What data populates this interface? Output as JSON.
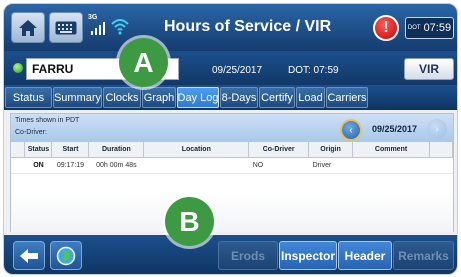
{
  "header": {
    "title": "Hours of Service / VIR",
    "network_label": "3G",
    "alert_label": "!",
    "dot_label": "DOT",
    "clock": "07:59"
  },
  "driver_bar": {
    "driver_name": "FARRU",
    "date": "09/25/2017",
    "dot_time": "DOT: 07:59",
    "vir_label": "VIR"
  },
  "tabs": [
    {
      "label": "Status"
    },
    {
      "label": "Summary"
    },
    {
      "label": "Clocks"
    },
    {
      "label": "Graph"
    },
    {
      "label": "Day Log",
      "active": true
    },
    {
      "label": "8-Days"
    },
    {
      "label": "Certify"
    },
    {
      "label": "Load"
    },
    {
      "label": "Carriers"
    }
  ],
  "day_log": {
    "timezone_note": "Times shown in PDT",
    "codriver_label": "Co-Driver:",
    "prev_label": "‹",
    "next_label": "›",
    "date": "09/25/2017",
    "columns": [
      "Status",
      "Start",
      "Duration",
      "Location",
      "Co-Driver",
      "Origin",
      "Comment"
    ],
    "rows": [
      {
        "status": "ON",
        "start": "09:17:19",
        "duration": "00h 00m 48s",
        "location": "",
        "codriver": "NO",
        "origin": "Driver",
        "comment": ""
      }
    ]
  },
  "bottom_bar": {
    "erods_label": "Erods",
    "inspector_label": "Inspector",
    "header_label": "Header",
    "remarks_label": "Remarks"
  },
  "callouts": {
    "a": "A",
    "b": "B"
  },
  "colors": {
    "accent": "#2c7bd8",
    "callout": "#3d9a42",
    "alert": "#c40000"
  }
}
